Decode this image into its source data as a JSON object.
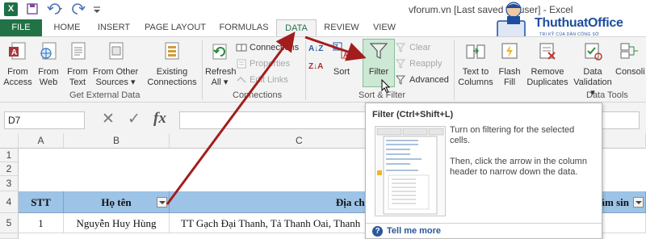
{
  "title_bar": {
    "title": "vforum.vn [Last saved by user] - Excel",
    "logo_letter": "X"
  },
  "tabs": [
    {
      "label": "FILE"
    },
    {
      "label": "HOME"
    },
    {
      "label": "INSERT"
    },
    {
      "label": "PAGE LAYOUT"
    },
    {
      "label": "FORMULAS"
    },
    {
      "label": "DATA"
    },
    {
      "label": "REVIEW"
    },
    {
      "label": "VIEW"
    }
  ],
  "active_tab": "DATA",
  "ribbon": {
    "get_external_data": {
      "label": "Get External Data",
      "buttons": [
        {
          "line1": "From",
          "line2": "Access"
        },
        {
          "line1": "From",
          "line2": "Web"
        },
        {
          "line1": "From",
          "line2": "Text"
        },
        {
          "line1": "From Other",
          "line2": "Sources ▾"
        },
        {
          "line1": "Existing",
          "line2": "Connections"
        }
      ]
    },
    "connections": {
      "label": "Connections",
      "refresh": {
        "line1": "Refresh",
        "line2": "All ▾"
      },
      "small": [
        "Connections",
        "Properties",
        "Edit Links"
      ]
    },
    "sort_filter": {
      "label": "Sort & Filter",
      "az": "A↓Z",
      "za": "Z↓A",
      "sort": "Sort",
      "filter": "Filter",
      "small": [
        "Clear",
        "Reapply",
        "Advanced"
      ]
    },
    "data_tools": {
      "label": "Data Tools",
      "buttons": [
        {
          "line1": "Text to",
          "line2": "Columns"
        },
        {
          "line1": "Flash",
          "line2": "Fill"
        },
        {
          "line1": "Remove",
          "line2": "Duplicates"
        },
        {
          "line1": "Data",
          "line2": "Validation ▾"
        },
        {
          "line1": "Consoli",
          "line2": ""
        }
      ]
    }
  },
  "formula_bar": {
    "name_box": "D7",
    "fx": "fx",
    "value": ""
  },
  "grid": {
    "columns": [
      "A",
      "B",
      "C"
    ],
    "rows": [
      "1",
      "2",
      "3",
      "4",
      "5"
    ],
    "header_cells": [
      "STT",
      "Họ tên",
      "Địa chỉ",
      "y năm sin"
    ],
    "row5": [
      "1",
      "Nguyễn Huy Hùng",
      "TT Gạch Đại Thanh, Tả Thanh Oai, Thanh"
    ]
  },
  "tooltip": {
    "title": "Filter (Ctrl+Shift+L)",
    "desc1": "Turn on filtering for the selected cells.",
    "desc2": "Then, click the arrow in the column header to narrow down the data.",
    "more": "Tell me more"
  },
  "watermark": {
    "text": "ThuthuatOffice",
    "sub": "TRI KỸ CỦA DÂN CÔNG SỞ"
  },
  "colors": {
    "excel_green": "#217346",
    "header_fill": "#9dc3e6",
    "arrow_red": "#a31d1d",
    "watermark_blue": "#1d4e9e"
  }
}
